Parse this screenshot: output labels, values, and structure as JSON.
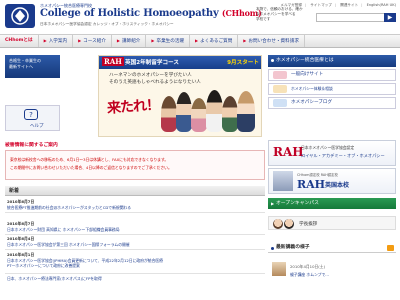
{
  "header": {
    "logo_small": "ホメオパシー統合医療専門校",
    "logo_main": "College of Holistic Homoeopathy",
    "logo_badge": "(CHhom)",
    "logo_sub": "日本ホメオパシー医学協会認定 カレッジ・オブ・ホリスティック・ホメオパシー",
    "desc_lines": [
      "本物で、信頼のおける、確か",
      "なホメオパシーを学べる",
      "学校です"
    ],
    "util_links": [
      "メルマガ登録",
      "サイトマップ",
      "関連サイト",
      "English(RAH UK)"
    ],
    "search_button": "▶"
  },
  "nav": {
    "items": [
      "CHhomとは",
      "入学案内",
      "コース紹介",
      "講師紹介",
      "卒業生の活躍",
      "よくあるご質問",
      "お問い合わせ・資料請求"
    ]
  },
  "left": {
    "banner_lines": [
      "合格生・卒業生の",
      "最新サイトへ"
    ],
    "help_label": "ヘルプ"
  },
  "hero": {
    "rah": "RAH",
    "title": "英国2年制留学コース",
    "start": "9月スタート",
    "line1": "ハーネマンのホメオパシーを学びたい人",
    "line2": "そのうえ英語もしゃべれるようになりたい人",
    "brush": "来たれ！"
  },
  "notice": {
    "title": "被害情報に関するご案内",
    "lines": [
      "東京校は新校舎への移転のため、6月1日～3日は休講とし、FAXにも対応できなくなります。",
      "この期間中にお問い合わせいただいた場合、4日以降のご返信となりますのでご了承ください。"
    ]
  },
  "news": {
    "heading": "新着",
    "items": [
      {
        "date": "2010年6月7日",
        "text": "統合医療PT推進期前の社会派ホメオパシーがスタッカとCDで新規関わる"
      },
      {
        "date": "2010年6月7日",
        "text": "日本ホメオパシー財団 高知県に ホメオパシー下部組織会員事務局"
      },
      {
        "date": "2010年6月4日",
        "text": "日本ホメオパシー医学協会が第三回 ホメオパシー国際フォーラムの開催"
      },
      {
        "date": "2010年6月1日",
        "text": "日本ホメオパシー医学協会(JPHMA)会員更新について、平成22年2月12日に政府が統合医療"
      }
    ],
    "extra_lines": [
      "PT一ホメオパシーについて政府に改善提案",
      "日本、ホメオパシー療法専門家(ホメオパス)にFPを取得"
    ]
  },
  "right": {
    "head1": "ホメオパシー統合医療とは",
    "sub1_tiny": "一般向け",
    "sub1": "一般向けサイト",
    "sub1b": "ホメオパシー体験＆相談",
    "sub2": "ホメオパシーブログ",
    "rah1_line1": "日本ホメオパシー医学協会認定",
    "rah1_line2": "ロイヤル・アカデミー・オブ・ホメオパシー",
    "rah2_small": "CHhom認定校 RAH認定校",
    "rah2_logo": "RAH",
    "rah2_title": "英国本校",
    "open_bar": "オープンキャンパス",
    "ph_label": "学長挨拶",
    "latest": "最新講義の様子",
    "blog_date": "2010年4月10日(土)",
    "blog_title": "親子講座 ホムンプで...",
    "rah_logo": "RAH"
  },
  "colors": {
    "brand": "#1a3a8c",
    "accent": "#d3002a",
    "green": "#1f8a45"
  }
}
